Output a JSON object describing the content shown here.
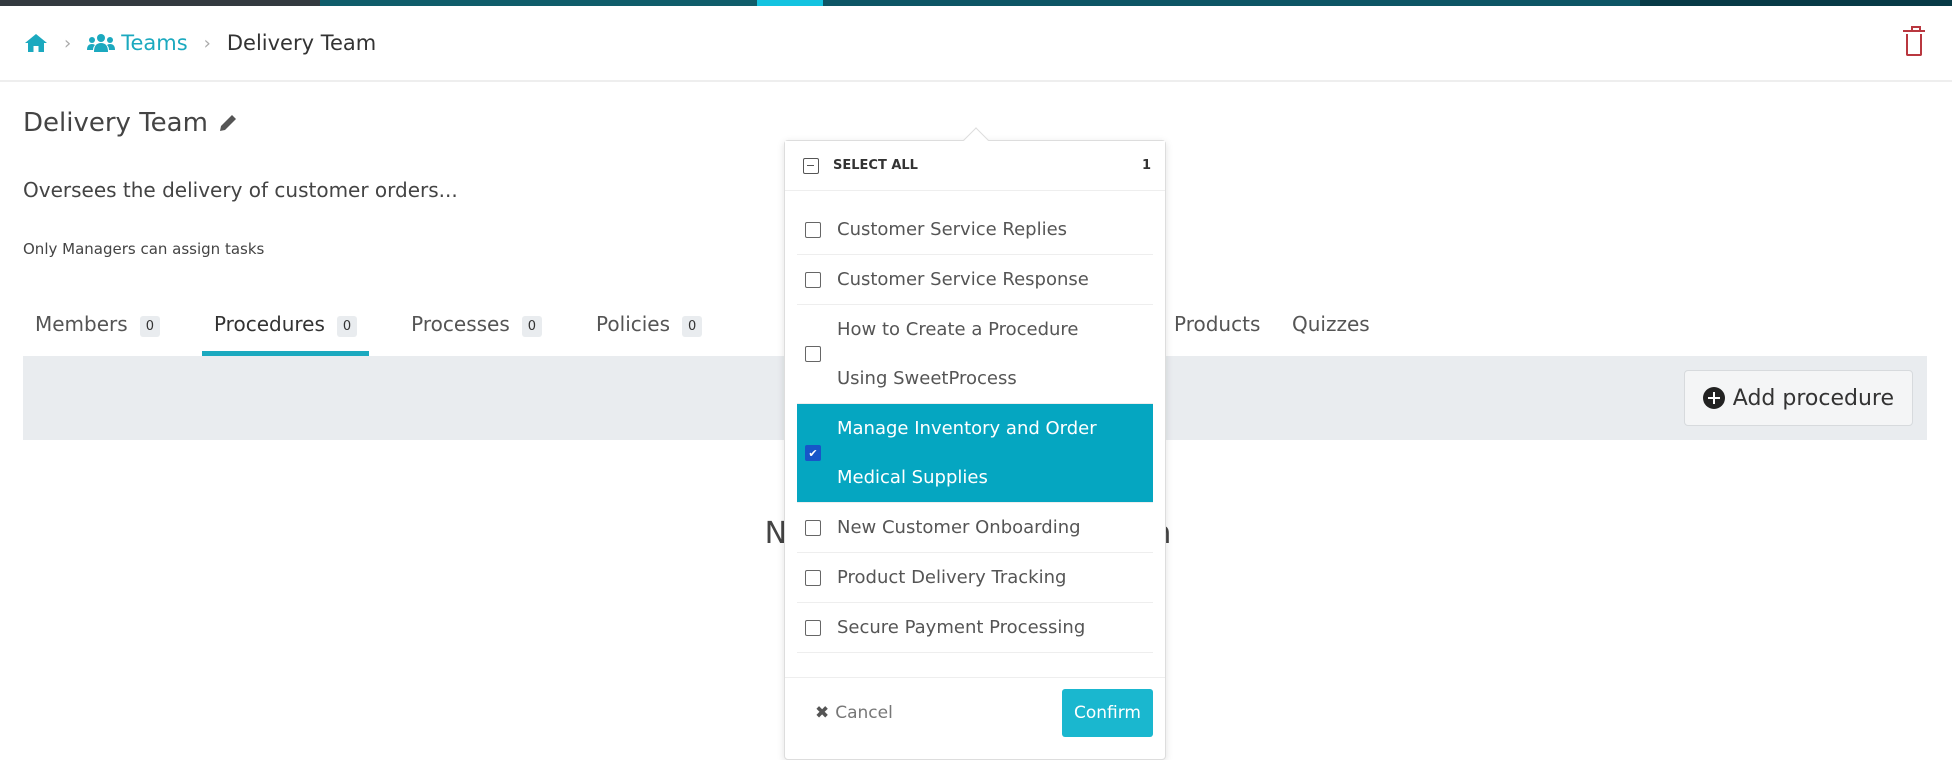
{
  "colors": {
    "accent": "#1ba9bf",
    "selected_bg": "#05a6c1",
    "checkbox_checked": "#1755c8",
    "danger": "#b9373f",
    "topbar": [
      "#333a40",
      "#0f5d6a",
      "#14c3e0",
      "#0d5565",
      "#073a46"
    ]
  },
  "breadcrumb": {
    "home_icon": "home-icon",
    "teams_icon": "users-icon",
    "teams": "Teams",
    "current": "Delivery Team"
  },
  "header": {
    "delete_icon": "trash-icon"
  },
  "team": {
    "name": "Delivery Team",
    "edit_icon": "pencil-icon",
    "description": "Oversees the delivery of customer orders...",
    "note": "Only Managers can assign tasks"
  },
  "tabs": [
    {
      "label": "Members",
      "count": "0"
    },
    {
      "label": "Procedures",
      "count": "0",
      "active": true
    },
    {
      "label": "Processes",
      "count": "0"
    },
    {
      "label": "Policies",
      "count": "0"
    },
    {
      "label": "Products"
    },
    {
      "label": "Quizzes"
    }
  ],
  "toolbar": {
    "add_label": "Add procedure"
  },
  "empty": {
    "text": "No procedures in this team"
  },
  "popover": {
    "select_all": "SELECT ALL",
    "count": "1",
    "items": [
      {
        "label": "Customer Service Replies",
        "checked": false
      },
      {
        "label": "Customer Service Response",
        "checked": false
      },
      {
        "label": "How to Create a Procedure Using SweetProcess",
        "checked": false
      },
      {
        "label": "Manage Inventory and Order Medical Supplies",
        "checked": true
      },
      {
        "label": "New Customer Onboarding",
        "checked": false
      },
      {
        "label": "Product Delivery Tracking",
        "checked": false
      },
      {
        "label": "Secure Payment Processing",
        "checked": false
      }
    ],
    "cancel": "Cancel",
    "confirm": "Confirm"
  }
}
